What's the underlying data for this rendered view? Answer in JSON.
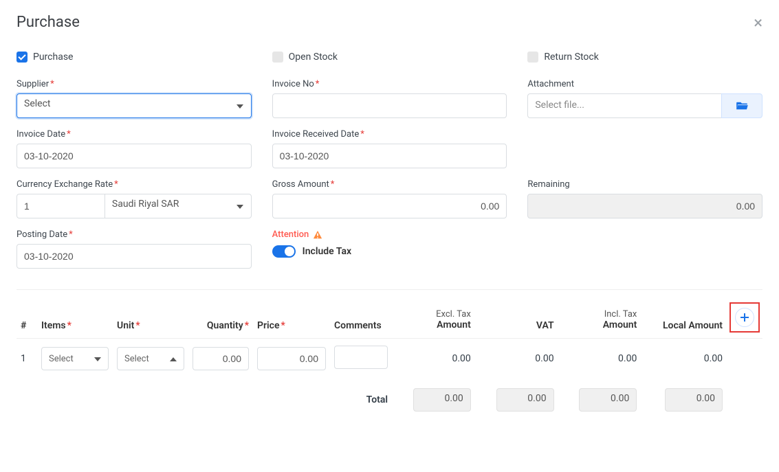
{
  "header": {
    "title": "Purchase"
  },
  "checks": {
    "purchase": "Purchase",
    "open_stock": "Open Stock",
    "return_stock": "Return Stock"
  },
  "fields": {
    "supplier_label": "Supplier",
    "supplier_value": "Select",
    "invoice_no_label": "Invoice No",
    "invoice_no_value": "",
    "attachment_label": "Attachment",
    "attachment_placeholder": "Select file...",
    "invoice_date_label": "Invoice Date",
    "invoice_date_value": "03-10-2020",
    "invoice_rec_label": "Invoice Received Date",
    "invoice_rec_value": "03-10-2020",
    "cex_label": "Currency Exchange Rate",
    "cex_rate": "1",
    "cex_currency": "Saudi Riyal SAR",
    "gross_label": "Gross Amount",
    "gross_value": "0.00",
    "remaining_label": "Remaining",
    "remaining_value": "0.00",
    "posting_label": "Posting Date",
    "posting_value": "03-10-2020",
    "attention_label": "Attention",
    "include_tax_label": "Include Tax"
  },
  "table": {
    "headers": {
      "index": "#",
      "items": "Items",
      "unit": "Unit",
      "qty": "Quantity",
      "price": "Price",
      "comments": "Comments",
      "excl_sub": "Excl. Tax",
      "excl_main": "Amount",
      "vat": "VAT",
      "incl_sub": "Incl. Tax",
      "incl_main": "Amount",
      "local": "Local Amount"
    },
    "row": {
      "idx": "1",
      "item_sel": "Select",
      "unit_sel": "Select",
      "qty": "0.00",
      "price": "0.00",
      "comments": "",
      "excl": "0.00",
      "vat": "0.00",
      "incl": "0.00",
      "local": "0.00"
    },
    "totals": {
      "label": "Total",
      "excl": "0.00",
      "vat": "0.00",
      "incl": "0.00",
      "local": "0.00"
    }
  }
}
